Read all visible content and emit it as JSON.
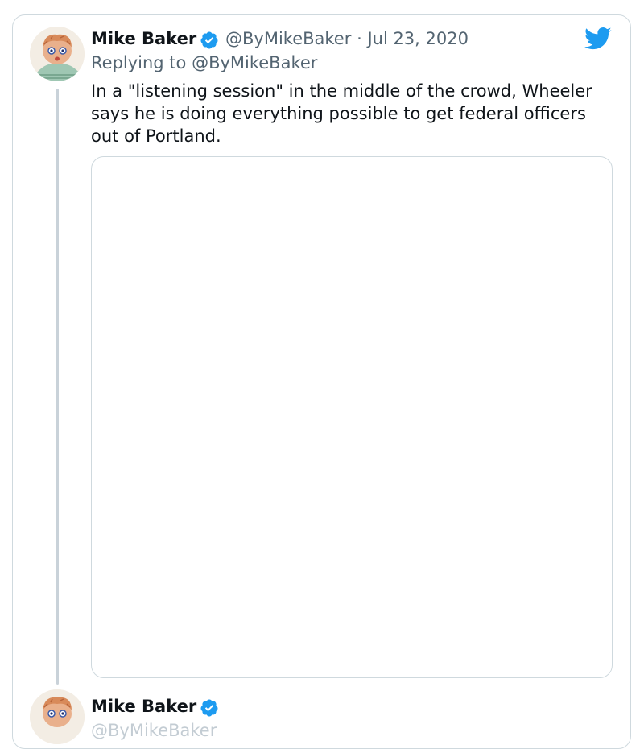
{
  "tweet": {
    "author_name": "Mike Baker",
    "handle": "@ByMikeBaker",
    "separator": "·",
    "date": "Jul 23, 2020",
    "replying_to": "Replying to @ByMikeBaker",
    "text": "In a \"listening session\" in the middle of the crowd, Wheeler says he is doing everything possible to get federal officers out of Portland."
  },
  "next_tweet": {
    "author_name": "Mike Baker",
    "handle_partial": "@ByMikeBaker"
  },
  "icons": {
    "verified": "verified-badge-icon",
    "brand": "twitter-bird-icon"
  },
  "colors": {
    "verified_blue": "#1d9bf0",
    "twitter_blue": "#1d9bf0",
    "secondary_text": "#536471",
    "border": "#cfd9de"
  }
}
